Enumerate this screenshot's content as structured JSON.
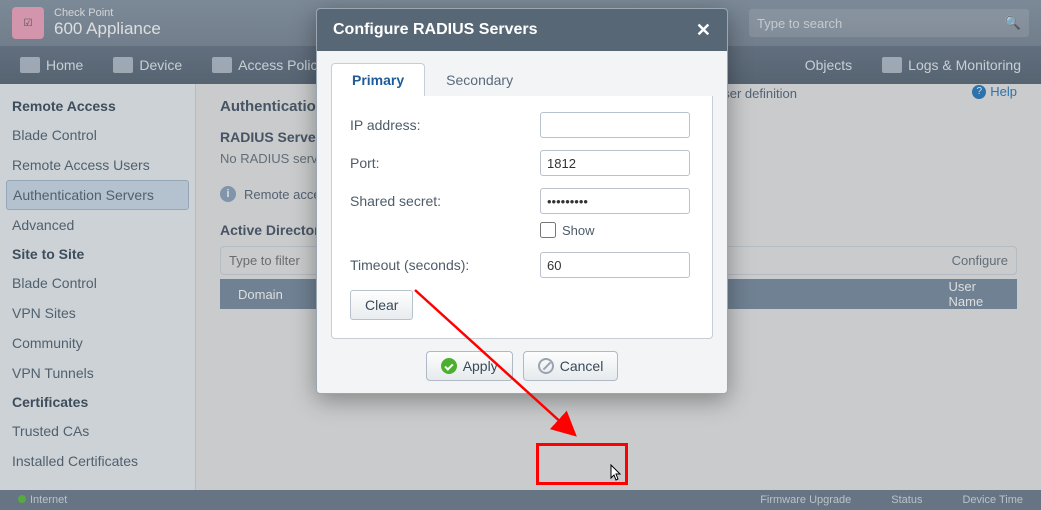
{
  "brand": {
    "small": "Check Point",
    "big": "600 Appliance"
  },
  "search": {
    "placeholder": "Type to search"
  },
  "main_tabs": [
    "Home",
    "Device",
    "Access Policy",
    "Objects",
    "Logs & Monitoring"
  ],
  "sidebar": {
    "groups": [
      {
        "title": "Remote Access",
        "items": [
          "Blade Control",
          "Remote Access Users",
          "Authentication Servers",
          "Advanced"
        ],
        "active_index": 2
      },
      {
        "title": "Site to Site",
        "items": [
          "Blade Control",
          "VPN Sites",
          "Community",
          "VPN Tunnels"
        ]
      },
      {
        "title": "Certificates",
        "items": [
          "Trusted CAs",
          "Installed Certificates"
        ]
      }
    ]
  },
  "content": {
    "page_title": "Authentication Servers",
    "permissions_hint": "user definition",
    "help_label": "Help",
    "radius": {
      "heading": "RADIUS Servers",
      "empty": "No RADIUS servers"
    },
    "info_note": "Remote access",
    "ad": {
      "heading": "Active Directory",
      "filter_placeholder": "Type to filter",
      "configure_label": "Configure",
      "columns": [
        "Domain",
        "User Name"
      ]
    }
  },
  "modal": {
    "title": "Configure RADIUS Servers",
    "tabs": [
      "Primary",
      "Secondary"
    ],
    "active_tab": 0,
    "fields": {
      "ip_label": "IP address:",
      "ip_value": "",
      "port_label": "Port:",
      "port_value": "1812",
      "secret_label": "Shared secret:",
      "secret_value": "•••••••••",
      "show_label": "Show",
      "timeout_label": "Timeout (seconds):",
      "timeout_value": "60"
    },
    "clear": "Clear",
    "apply": "Apply",
    "cancel": "Cancel"
  },
  "footer": {
    "internet": "Internet",
    "fw": "Firmware Upgrade",
    "status": "Status",
    "time": "Device Time"
  }
}
